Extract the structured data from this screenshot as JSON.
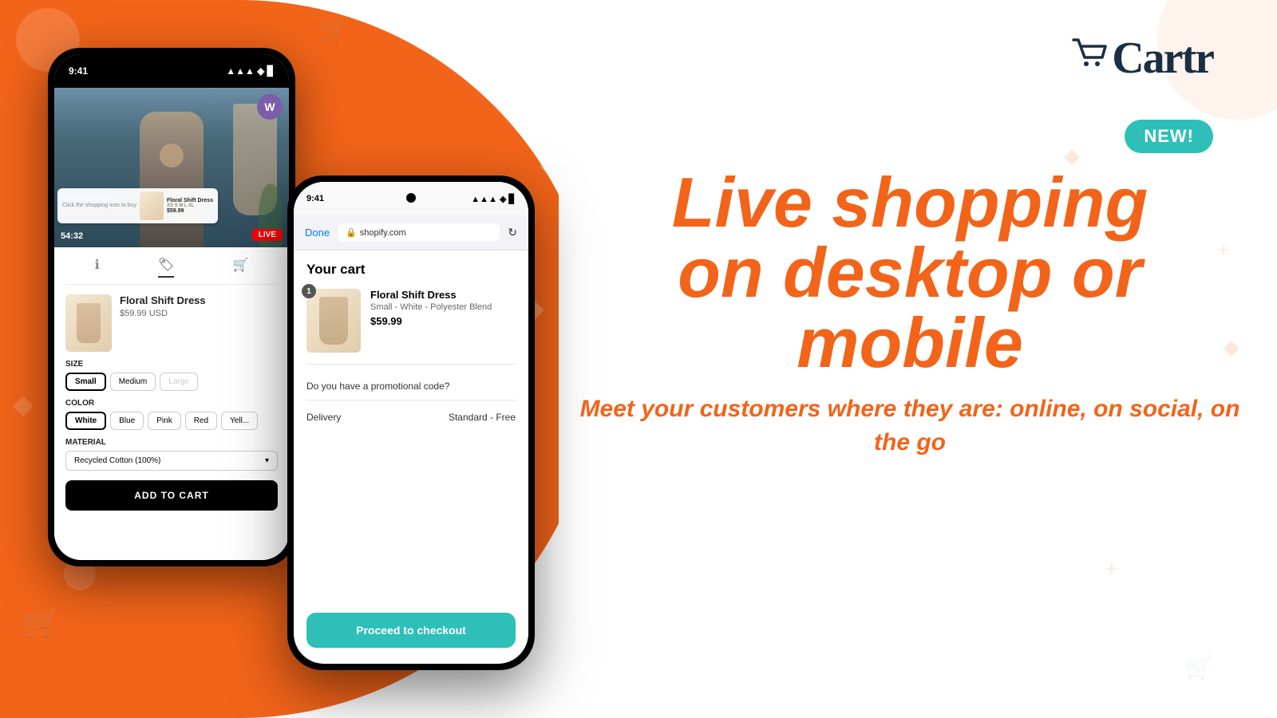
{
  "brand": {
    "logo_text": "Cartr",
    "tagline": "NEW!"
  },
  "headline": {
    "line1": "Live shopping",
    "line2": "on desktop or",
    "line3": "mobile",
    "subtext": "Meet your customers where they are: online, on social, on the go"
  },
  "phone1": {
    "status_time": "9:41",
    "tabs": [
      "info",
      "tag",
      "cart"
    ],
    "product": {
      "name": "Floral Shift Dress",
      "price": "$59.99 USD",
      "size_label": "SIZE",
      "sizes": [
        "Small",
        "Medium",
        "Large"
      ],
      "selected_size": "Small",
      "color_label": "COLOR",
      "colors": [
        "White",
        "Blue",
        "Pink",
        "Red",
        "Yellow"
      ],
      "selected_color": "White",
      "material_label": "MATERIAL",
      "material_value": "Recycled Cotton (100%)",
      "add_to_cart": "ADD TO CART"
    },
    "livestream": {
      "overlay_text": "Click the shopping icon to buy",
      "product_popup": "Floral Shift Dress\nXS S M L XL\n$59.99",
      "fb_handle": "@WillowBoutique",
      "timer": "54:32",
      "live_label": "LIVE",
      "avatar_initial": "W"
    }
  },
  "phone2": {
    "status_time": "9:41",
    "browser": {
      "done_label": "Done",
      "url": "shopify.com",
      "lock_icon": "🔒"
    },
    "cart": {
      "title": "Your cart",
      "item": {
        "name": "Floral Shift Dress",
        "variant": "Small - White - Polyester Blend",
        "price": "$59.99",
        "qty": "1"
      },
      "promo_label": "Do you have a promotional code?",
      "delivery_label": "Delivery",
      "delivery_value": "Standard - Free",
      "checkout_btn": "Proceed to checkout"
    }
  }
}
